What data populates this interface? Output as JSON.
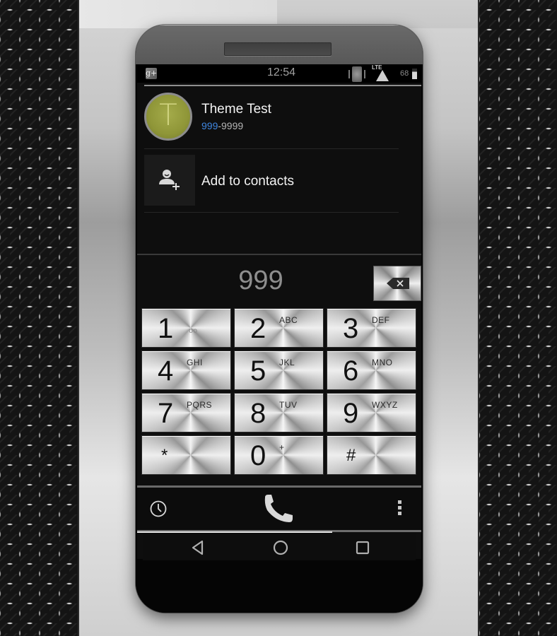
{
  "status_bar": {
    "time": "12:54",
    "network": "LTE",
    "battery_percent": "68",
    "icons": [
      "google-plus-icon",
      "vibrate-icon",
      "signal-icon",
      "battery-icon"
    ]
  },
  "contact_result": {
    "avatar_letter": "T",
    "avatar_color": "#9aa040",
    "name": "Theme Test",
    "number_match": "999",
    "number_rest": "-9999",
    "match_color": "#3f86e0"
  },
  "add_contact": {
    "label": "Add to contacts",
    "icon": "add-person-icon"
  },
  "dialer": {
    "digits": "999",
    "backspace_icon": "backspace-icon"
  },
  "keypad": [
    {
      "num": "1",
      "letters": "",
      "voicemail": "oo"
    },
    {
      "num": "2",
      "letters": "ABC"
    },
    {
      "num": "3",
      "letters": "DEF"
    },
    {
      "num": "4",
      "letters": "GHI"
    },
    {
      "num": "5",
      "letters": "JKL"
    },
    {
      "num": "6",
      "letters": "MNO"
    },
    {
      "num": "7",
      "letters": "PQRS"
    },
    {
      "num": "8",
      "letters": "TUV"
    },
    {
      "num": "9",
      "letters": "WXYZ"
    },
    {
      "num": "*",
      "letters": ""
    },
    {
      "num": "0",
      "letters": "+"
    },
    {
      "num": "#",
      "letters": ""
    }
  ],
  "bottom_bar": {
    "left_icon": "history-icon",
    "center_icon": "phone-call-icon",
    "right_icon": "overflow-menu-icon"
  },
  "nav_bar": {
    "icons": [
      "back-icon",
      "home-icon",
      "recents-icon"
    ]
  }
}
